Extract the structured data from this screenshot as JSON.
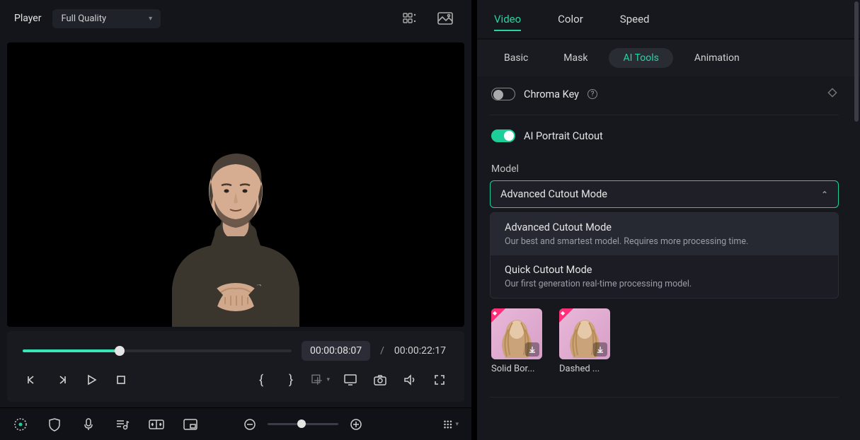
{
  "player": {
    "label": "Player",
    "quality": "Full Quality"
  },
  "time": {
    "current": "00:00:08:07",
    "sep": "/",
    "total": "00:00:22:17",
    "progress_pct": 36
  },
  "zoom": {
    "pct": 42
  },
  "top_tabs": [
    "Video",
    "Color",
    "Speed"
  ],
  "top_tab_active_index": 0,
  "sub_tabs": [
    "Basic",
    "Mask",
    "AI Tools",
    "Animation"
  ],
  "sub_tab_active_index": 2,
  "features": {
    "chroma_key": {
      "label": "Chroma Key",
      "enabled": false
    },
    "ai_portrait_cutout": {
      "label": "AI Portrait Cutout",
      "enabled": true
    }
  },
  "model": {
    "section_label": "Model",
    "selected": "Advanced Cutout Mode",
    "options": [
      {
        "title": "Advanced Cutout Mode",
        "desc": "Our best and smartest model. Requires more processing time."
      },
      {
        "title": "Quick Cutout Mode",
        "desc": "Our first generation real-time processing model."
      }
    ]
  },
  "presets": [
    {
      "label": "Solid Bor..."
    },
    {
      "label": "Dashed ..."
    }
  ],
  "icons": {
    "grid": "grid-icon",
    "image": "image-icon"
  }
}
